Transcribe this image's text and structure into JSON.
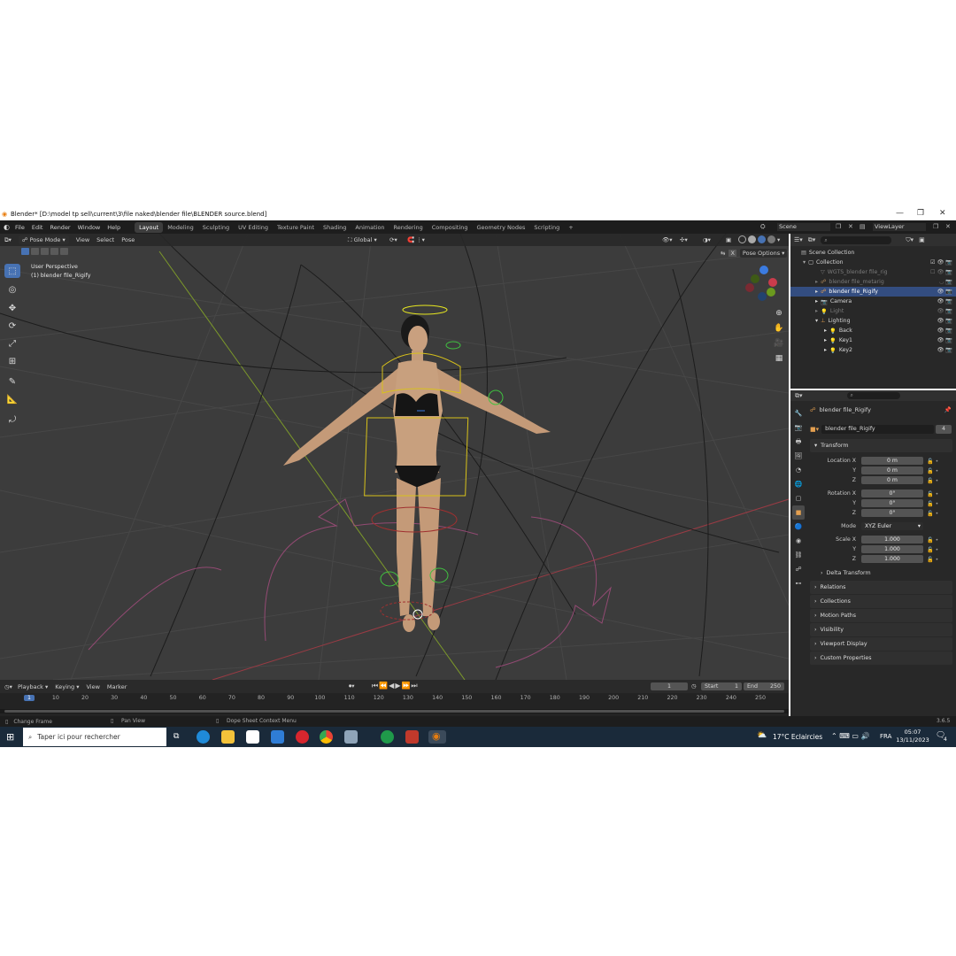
{
  "window": {
    "title": "Blender* [D:\\model tp sell\\current\\3\\file naked\\blender file\\BLENDER source.blend]",
    "minimize": "—",
    "maximize": "❐",
    "close": "✕"
  },
  "menu": [
    "File",
    "Edit",
    "Render",
    "Window",
    "Help"
  ],
  "workspaces": [
    "Layout",
    "Modeling",
    "Sculpting",
    "UV Editing",
    "Texture Paint",
    "Shading",
    "Animation",
    "Rendering",
    "Compositing",
    "Geometry Nodes",
    "Scripting"
  ],
  "active_workspace": "Layout",
  "scene": {
    "label": "Scene",
    "view_layer": "ViewLayer"
  },
  "viewport": {
    "mode": "Pose Mode",
    "menus": [
      "View",
      "Select",
      "Pose"
    ],
    "orientation": "Global",
    "pose_options": "Pose Options",
    "info_line1": "User Perspective",
    "info_line2": "(1) blender file_Rigify",
    "x_btn": "X"
  },
  "outliner": {
    "root": "Scene Collection",
    "rows": [
      {
        "name": "Collection",
        "indent": 1
      },
      {
        "name": "WGTS_blender file_rig",
        "indent": 2
      },
      {
        "name": "blender file_metarig",
        "indent": 2
      },
      {
        "name": "blender file_Rigify",
        "indent": 2
      },
      {
        "name": "Camera",
        "indent": 2
      },
      {
        "name": "Light",
        "indent": 2
      },
      {
        "name": "Lighting",
        "indent": 2
      },
      {
        "name": "Back",
        "indent": 3
      },
      {
        "name": "Key1",
        "indent": 3
      },
      {
        "name": "Key2",
        "indent": 3
      }
    ]
  },
  "properties": {
    "object_name": "blender file_Rigify",
    "data_name": "blender file_Rigify",
    "users": "4",
    "transform_label": "Transform",
    "location_label": "Location X",
    "location": [
      "0 m",
      "0 m",
      "0 m"
    ],
    "rotation_label": "Rotation X",
    "rotation": [
      "0°",
      "0°",
      "0°"
    ],
    "mode_label": "Mode",
    "mode_value": "XYZ Euler",
    "scale_label": "Scale X",
    "scale": [
      "1.000",
      "1.000",
      "1.000"
    ],
    "axis_y": "Y",
    "axis_z": "Z",
    "delta": "Delta Transform",
    "sections": [
      "Relations",
      "Collections",
      "Motion Paths",
      "Visibility",
      "Viewport Display",
      "Custom Properties"
    ]
  },
  "timeline": {
    "menus": [
      "Playback",
      "Keying",
      "View",
      "Marker"
    ],
    "current_frame": "1",
    "start_label": "Start",
    "start": "1",
    "end_label": "End",
    "end": "250",
    "ticks": [
      "1",
      "10",
      "20",
      "30",
      "40",
      "50",
      "60",
      "70",
      "80",
      "90",
      "100",
      "110",
      "120",
      "130",
      "140",
      "150",
      "160",
      "170",
      "180",
      "190",
      "200",
      "210",
      "220",
      "230",
      "240",
      "250"
    ]
  },
  "status": {
    "left": "Change Frame",
    "mid": "Pan View",
    "right": "Dope Sheet Context Menu",
    "version": "3.6.5"
  },
  "taskbar": {
    "search_placeholder": "Taper ici pour rechercher",
    "weather": "17°C  Eclaircies",
    "lang": "FRA",
    "time": "05:07",
    "date": "13/11/2023",
    "notif": "4"
  }
}
